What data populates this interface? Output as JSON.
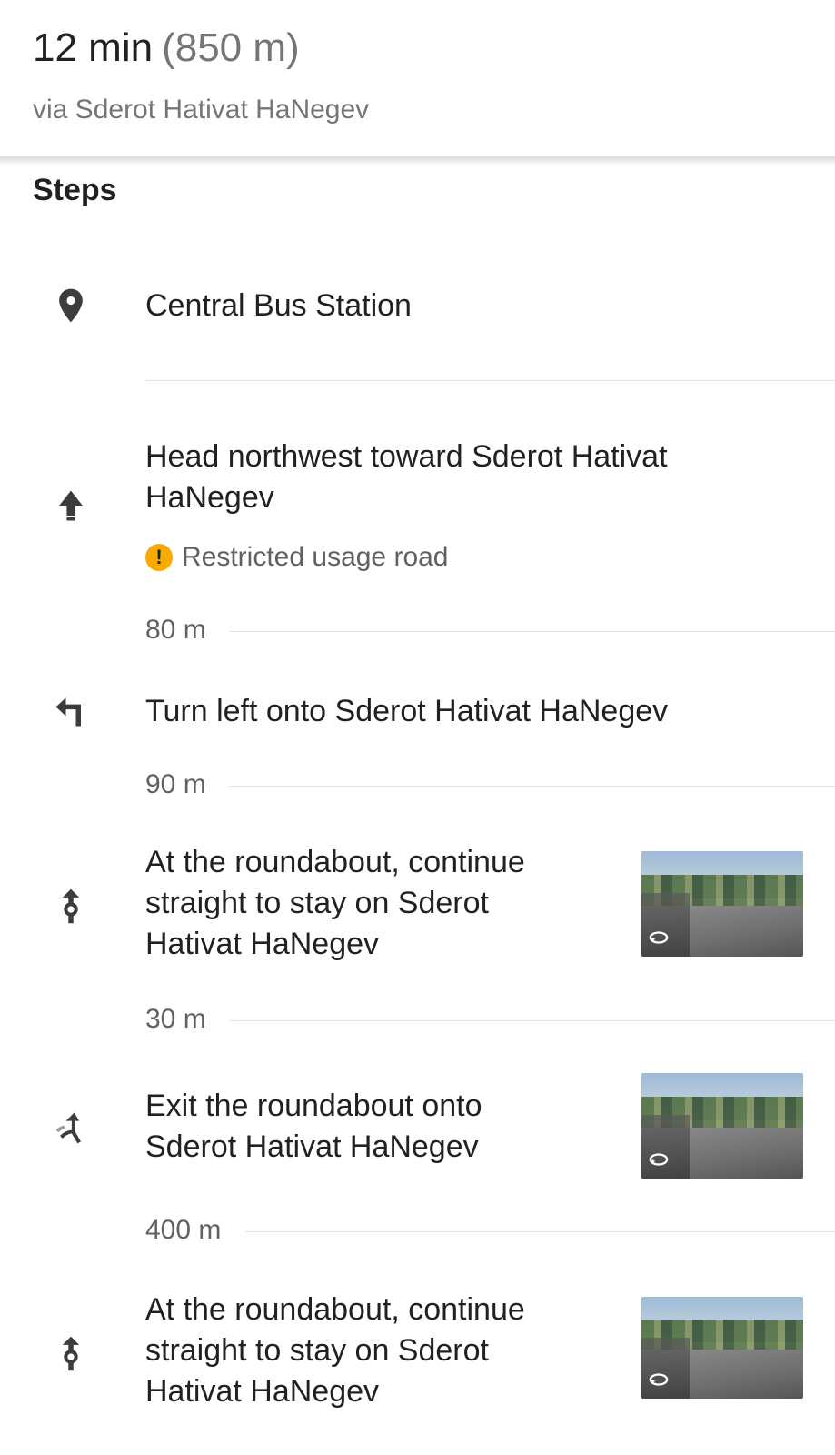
{
  "header": {
    "duration": "12 min",
    "distance": "(850 m)",
    "via": "via Sderot Hativat HaNegev"
  },
  "steps_title": "Steps",
  "origin": {
    "icon": "location-pin-icon",
    "label": "Central Bus Station"
  },
  "steps": [
    {
      "icon": "arrow-up-icon",
      "line1": "Head northwest toward Sderot Hativat",
      "line2": "HaNegev",
      "warning": "Restricted usage road",
      "warning_icon": "exclamation-icon",
      "distance": "80 m"
    },
    {
      "icon": "turn-left-icon",
      "line1": "Turn left onto Sderot Hativat HaNegev",
      "distance": "90 m"
    },
    {
      "icon": "roundabout-straight-icon",
      "line1": "At the roundabout, continue",
      "line2": "straight to stay on Sderot",
      "line3": "Hativat HaNegev",
      "thumbnail": "street-view-thumbnail",
      "distance": "30 m"
    },
    {
      "icon": "roundabout-exit-icon",
      "line1": "Exit the roundabout onto",
      "line2": "Sderot Hativat HaNegev",
      "thumbnail": "street-view-thumbnail",
      "distance": "400 m"
    },
    {
      "icon": "roundabout-straight-icon",
      "line1": "At the roundabout, continue",
      "line2": "straight to stay on Sderot",
      "line3": "Hativat HaNegev",
      "thumbnail": "street-view-thumbnail"
    }
  ],
  "colors": {
    "warning": "#f9ab00",
    "secondary_text": "#757575",
    "primary_text": "#212121"
  }
}
